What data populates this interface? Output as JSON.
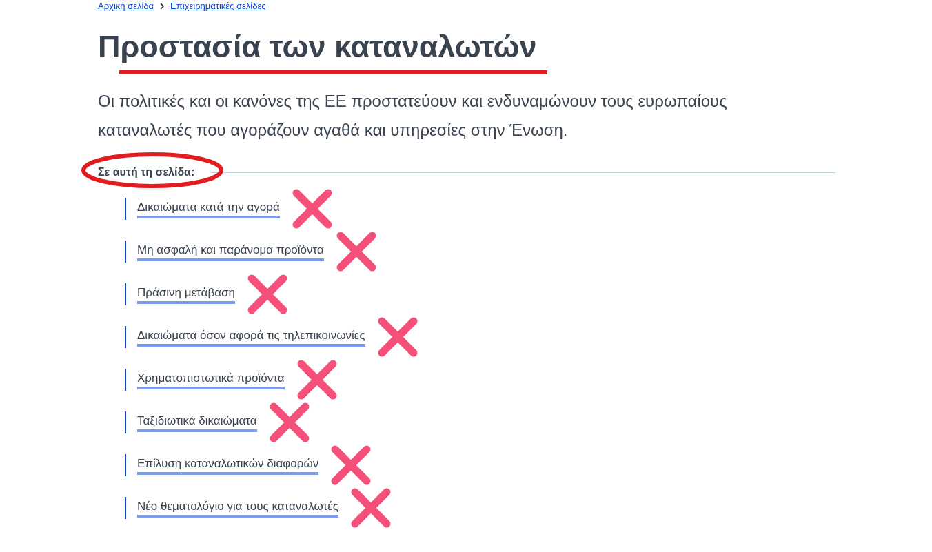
{
  "breadcrumb": [
    {
      "label": "Αρχική σελίδα"
    },
    {
      "label": "Επιχειρηματικές σελίδες"
    }
  ],
  "title": "Προστασία των καταναλωτών",
  "title_underlined": true,
  "intro": "Οι πολιτικές και οι κανόνες της ΕΕ προστατεύουν και ενδυναμώνουν τους ευρωπαίους καταναλωτές που αγοράζουν αγαθά και υπηρεσίες στην Ένωση.",
  "on_this_page": {
    "heading": "Σε αυτή τη σελίδα:",
    "circled": true,
    "links": [
      {
        "label": "Δικαιώματα κατά την αγορά",
        "crossed_out": true
      },
      {
        "label": "Μη ασφαλή και παράνομα προϊόντα",
        "crossed_out": true
      },
      {
        "label": "Πράσινη μετάβαση",
        "crossed_out": true
      },
      {
        "label": "Δικαιώματα όσον αφορά τις τηλεπικοινωνίες",
        "crossed_out": true
      },
      {
        "label": "Χρηματοπιστωτικά προϊόντα",
        "crossed_out": true
      },
      {
        "label": "Ταξιδιωτικά δικαιώματα",
        "crossed_out": true
      },
      {
        "label": "Επίλυση καταναλωτικών διαφορών",
        "crossed_out": true
      },
      {
        "label": "Νέο θεματολόγιο για τους καταναλωτές",
        "crossed_out": true
      }
    ]
  }
}
